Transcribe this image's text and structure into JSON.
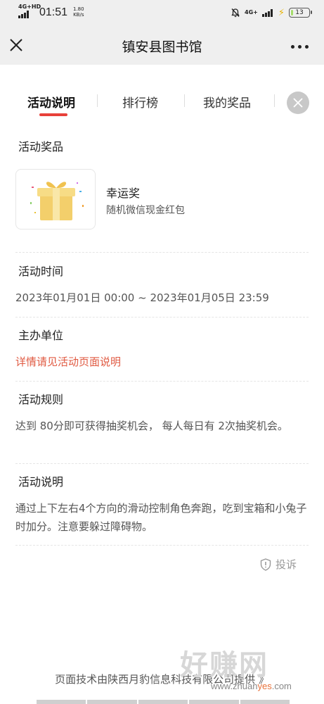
{
  "status_bar": {
    "network_left": "4G+HD",
    "time": "01:51",
    "speed_value": "1.80",
    "speed_unit": "KB/s",
    "network_right": "4G+",
    "battery": "13",
    "battery_level_percent": 13
  },
  "nav": {
    "title": "镇安县图书馆"
  },
  "tabs": [
    {
      "label": "活动说明",
      "active": true
    },
    {
      "label": "排行榜",
      "active": false
    },
    {
      "label": "我的奖品",
      "active": false
    }
  ],
  "sections": {
    "prize": {
      "label": "活动奖品",
      "prize_name": "幸运奖",
      "prize_desc": "随机微信现金红包"
    },
    "time": {
      "label": "活动时间",
      "value": "2023年01月01日 00:00 ~ 2023年01月05日 23:59"
    },
    "organizer": {
      "label": "主办单位",
      "value": "详情请见活动页面说明"
    },
    "rules": {
      "label": "活动规则",
      "value": "达到 80分即可获得抽奖机会， 每人每日有 2次抽奖机会。"
    },
    "description": {
      "label": "活动说明",
      "value": "通过上下左右4个方向的滑动控制角色奔跑，吃到宝箱和小兔子时加分。注意要躲过障碍物。"
    }
  },
  "report": {
    "label": "投诉"
  },
  "footer": {
    "text": "页面技术由陕西月豹信息科技有限公司提供 》"
  },
  "watermark": {
    "brand": "好赚网",
    "url_prefix": "www.zhuan",
    "url_mid": "yes",
    "url_suffix": ".com"
  },
  "colors": {
    "accent_red": "#e8413a",
    "label_highlight": "#fbd8d6",
    "organizer_text": "#e05a42"
  }
}
